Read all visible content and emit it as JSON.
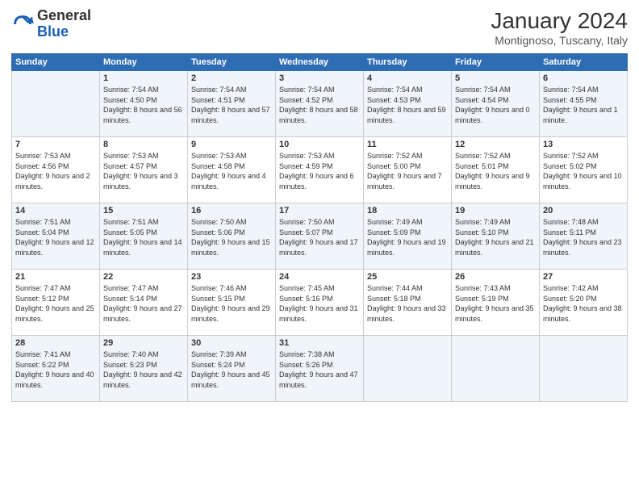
{
  "header": {
    "logo_general": "General",
    "logo_blue": "Blue",
    "month_title": "January 2024",
    "subtitle": "Montignoso, Tuscany, Italy"
  },
  "days_of_week": [
    "Sunday",
    "Monday",
    "Tuesday",
    "Wednesday",
    "Thursday",
    "Friday",
    "Saturday"
  ],
  "weeks": [
    [
      {
        "day": "",
        "sunrise": "",
        "sunset": "",
        "daylight": ""
      },
      {
        "day": "1",
        "sunrise": "Sunrise: 7:54 AM",
        "sunset": "Sunset: 4:50 PM",
        "daylight": "Daylight: 8 hours and 56 minutes."
      },
      {
        "day": "2",
        "sunrise": "Sunrise: 7:54 AM",
        "sunset": "Sunset: 4:51 PM",
        "daylight": "Daylight: 8 hours and 57 minutes."
      },
      {
        "day": "3",
        "sunrise": "Sunrise: 7:54 AM",
        "sunset": "Sunset: 4:52 PM",
        "daylight": "Daylight: 8 hours and 58 minutes."
      },
      {
        "day": "4",
        "sunrise": "Sunrise: 7:54 AM",
        "sunset": "Sunset: 4:53 PM",
        "daylight": "Daylight: 8 hours and 59 minutes."
      },
      {
        "day": "5",
        "sunrise": "Sunrise: 7:54 AM",
        "sunset": "Sunset: 4:54 PM",
        "daylight": "Daylight: 9 hours and 0 minutes."
      },
      {
        "day": "6",
        "sunrise": "Sunrise: 7:54 AM",
        "sunset": "Sunset: 4:55 PM",
        "daylight": "Daylight: 9 hours and 1 minute."
      }
    ],
    [
      {
        "day": "7",
        "sunrise": "Sunrise: 7:53 AM",
        "sunset": "Sunset: 4:56 PM",
        "daylight": "Daylight: 9 hours and 2 minutes."
      },
      {
        "day": "8",
        "sunrise": "Sunrise: 7:53 AM",
        "sunset": "Sunset: 4:57 PM",
        "daylight": "Daylight: 9 hours and 3 minutes."
      },
      {
        "day": "9",
        "sunrise": "Sunrise: 7:53 AM",
        "sunset": "Sunset: 4:58 PM",
        "daylight": "Daylight: 9 hours and 4 minutes."
      },
      {
        "day": "10",
        "sunrise": "Sunrise: 7:53 AM",
        "sunset": "Sunset: 4:59 PM",
        "daylight": "Daylight: 9 hours and 6 minutes."
      },
      {
        "day": "11",
        "sunrise": "Sunrise: 7:52 AM",
        "sunset": "Sunset: 5:00 PM",
        "daylight": "Daylight: 9 hours and 7 minutes."
      },
      {
        "day": "12",
        "sunrise": "Sunrise: 7:52 AM",
        "sunset": "Sunset: 5:01 PM",
        "daylight": "Daylight: 9 hours and 9 minutes."
      },
      {
        "day": "13",
        "sunrise": "Sunrise: 7:52 AM",
        "sunset": "Sunset: 5:02 PM",
        "daylight": "Daylight: 9 hours and 10 minutes."
      }
    ],
    [
      {
        "day": "14",
        "sunrise": "Sunrise: 7:51 AM",
        "sunset": "Sunset: 5:04 PM",
        "daylight": "Daylight: 9 hours and 12 minutes."
      },
      {
        "day": "15",
        "sunrise": "Sunrise: 7:51 AM",
        "sunset": "Sunset: 5:05 PM",
        "daylight": "Daylight: 9 hours and 14 minutes."
      },
      {
        "day": "16",
        "sunrise": "Sunrise: 7:50 AM",
        "sunset": "Sunset: 5:06 PM",
        "daylight": "Daylight: 9 hours and 15 minutes."
      },
      {
        "day": "17",
        "sunrise": "Sunrise: 7:50 AM",
        "sunset": "Sunset: 5:07 PM",
        "daylight": "Daylight: 9 hours and 17 minutes."
      },
      {
        "day": "18",
        "sunrise": "Sunrise: 7:49 AM",
        "sunset": "Sunset: 5:09 PM",
        "daylight": "Daylight: 9 hours and 19 minutes."
      },
      {
        "day": "19",
        "sunrise": "Sunrise: 7:49 AM",
        "sunset": "Sunset: 5:10 PM",
        "daylight": "Daylight: 9 hours and 21 minutes."
      },
      {
        "day": "20",
        "sunrise": "Sunrise: 7:48 AM",
        "sunset": "Sunset: 5:11 PM",
        "daylight": "Daylight: 9 hours and 23 minutes."
      }
    ],
    [
      {
        "day": "21",
        "sunrise": "Sunrise: 7:47 AM",
        "sunset": "Sunset: 5:12 PM",
        "daylight": "Daylight: 9 hours and 25 minutes."
      },
      {
        "day": "22",
        "sunrise": "Sunrise: 7:47 AM",
        "sunset": "Sunset: 5:14 PM",
        "daylight": "Daylight: 9 hours and 27 minutes."
      },
      {
        "day": "23",
        "sunrise": "Sunrise: 7:46 AM",
        "sunset": "Sunset: 5:15 PM",
        "daylight": "Daylight: 9 hours and 29 minutes."
      },
      {
        "day": "24",
        "sunrise": "Sunrise: 7:45 AM",
        "sunset": "Sunset: 5:16 PM",
        "daylight": "Daylight: 9 hours and 31 minutes."
      },
      {
        "day": "25",
        "sunrise": "Sunrise: 7:44 AM",
        "sunset": "Sunset: 5:18 PM",
        "daylight": "Daylight: 9 hours and 33 minutes."
      },
      {
        "day": "26",
        "sunrise": "Sunrise: 7:43 AM",
        "sunset": "Sunset: 5:19 PM",
        "daylight": "Daylight: 9 hours and 35 minutes."
      },
      {
        "day": "27",
        "sunrise": "Sunrise: 7:42 AM",
        "sunset": "Sunset: 5:20 PM",
        "daylight": "Daylight: 9 hours and 38 minutes."
      }
    ],
    [
      {
        "day": "28",
        "sunrise": "Sunrise: 7:41 AM",
        "sunset": "Sunset: 5:22 PM",
        "daylight": "Daylight: 9 hours and 40 minutes."
      },
      {
        "day": "29",
        "sunrise": "Sunrise: 7:40 AM",
        "sunset": "Sunset: 5:23 PM",
        "daylight": "Daylight: 9 hours and 42 minutes."
      },
      {
        "day": "30",
        "sunrise": "Sunrise: 7:39 AM",
        "sunset": "Sunset: 5:24 PM",
        "daylight": "Daylight: 9 hours and 45 minutes."
      },
      {
        "day": "31",
        "sunrise": "Sunrise: 7:38 AM",
        "sunset": "Sunset: 5:26 PM",
        "daylight": "Daylight: 9 hours and 47 minutes."
      },
      {
        "day": "",
        "sunrise": "",
        "sunset": "",
        "daylight": ""
      },
      {
        "day": "",
        "sunrise": "",
        "sunset": "",
        "daylight": ""
      },
      {
        "day": "",
        "sunrise": "",
        "sunset": "",
        "daylight": ""
      }
    ]
  ]
}
